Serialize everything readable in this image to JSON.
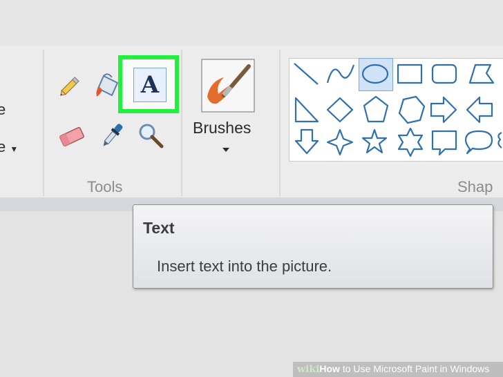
{
  "ribbon": {
    "truncated_labels": [
      "e",
      "e"
    ],
    "tools": {
      "group_label": "Tools",
      "items": [
        {
          "name": "pencil-icon"
        },
        {
          "name": "fill-bucket-icon"
        },
        {
          "name": "text-tool-icon",
          "glyph": "A",
          "selected": true
        },
        {
          "name": "eraser-icon"
        },
        {
          "name": "color-picker-icon"
        },
        {
          "name": "magnifier-icon"
        }
      ]
    },
    "brushes": {
      "label": "Brushes"
    },
    "shapes": {
      "group_label": "Shap"
    }
  },
  "tooltip": {
    "title": "Text",
    "description": "Insert text into the picture."
  },
  "watermark": {
    "brand": "wiki",
    "how": "How",
    "rest": " to Use Microsoft Paint in Windows"
  },
  "colors": {
    "highlight": "#22ee3c",
    "shape_stroke": "#2f6fb0",
    "text_icon": "#1f3357"
  }
}
